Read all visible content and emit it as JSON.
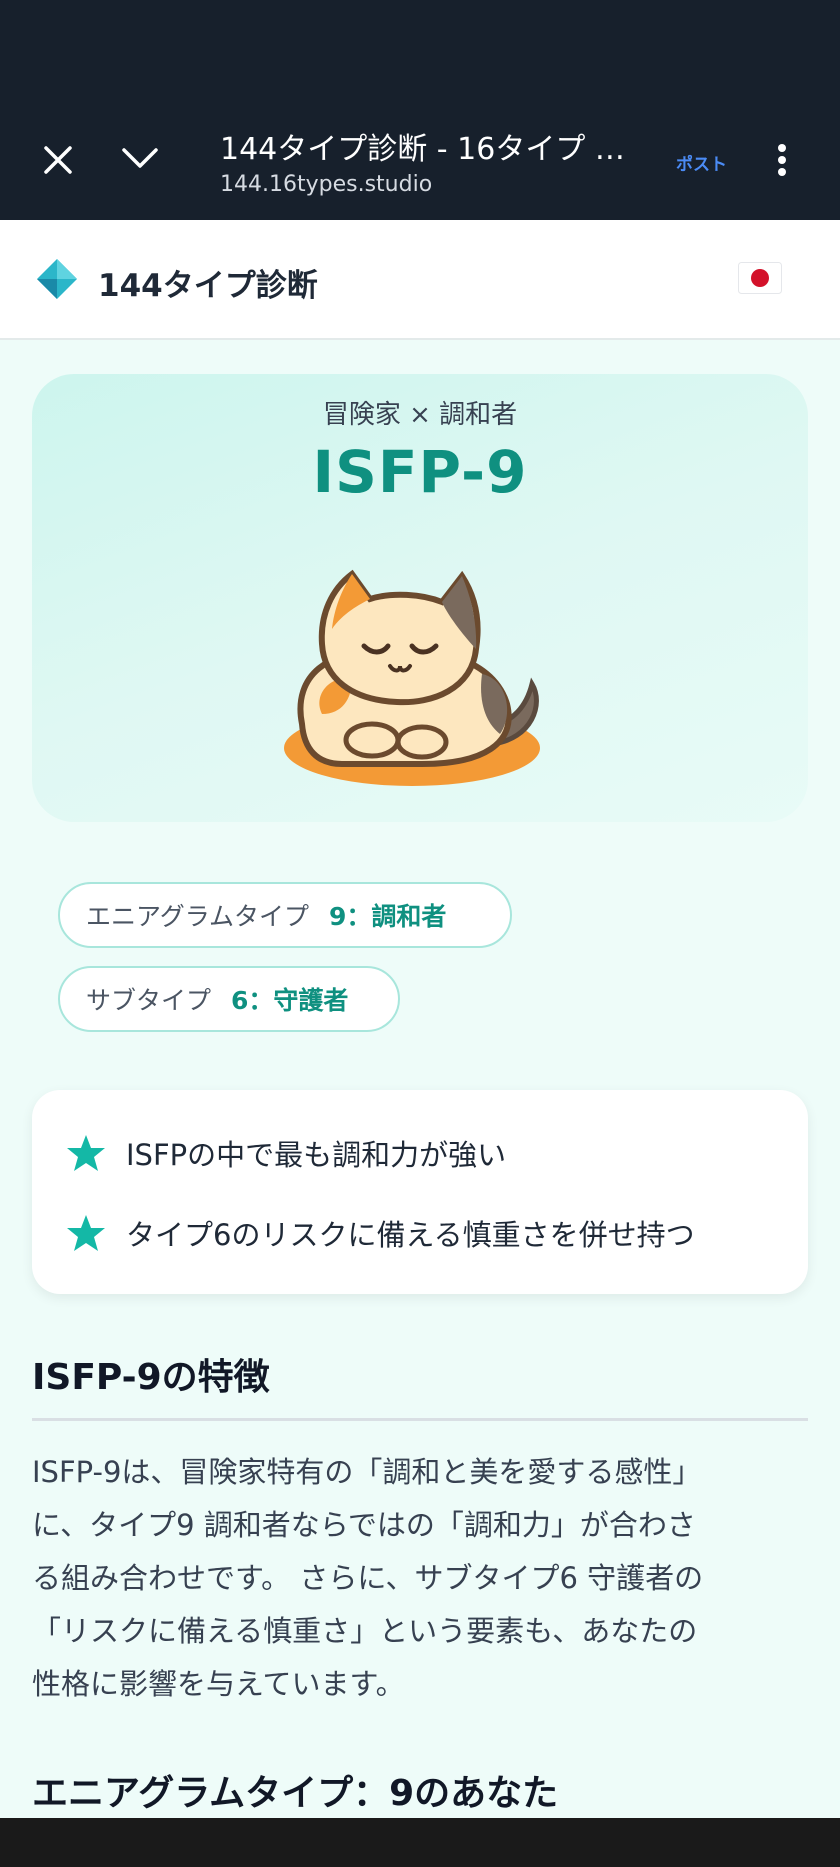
{
  "browser": {
    "tab_title": "144タイプ診断 - 16タイプ …",
    "url": "144.16types.studio",
    "post_label": "ポスト"
  },
  "header": {
    "site_title": "144タイプ診断",
    "flag_icon": "japan-flag-icon"
  },
  "hero": {
    "subtitle": "冒険家 × 調和者",
    "type_code": "ISFP-9",
    "illustration": "sleeping-cat-icon"
  },
  "badges": [
    {
      "label": "エニアグラムタイプ",
      "value": "9：調和者"
    },
    {
      "label": "サブタイプ",
      "value": "6：守護者"
    }
  ],
  "highlights": [
    "ISFPの中で最も調和力が強い",
    "タイプ6のリスクに備える慎重さを併せ持つ"
  ],
  "section": {
    "title": "ISFP-9の特徴",
    "body_lines": [
      "ISFP-9は、冒険家特有の「調和と美を愛する感性」",
      "に、タイプ9 調和者ならではの「調和力」が合わさ",
      "る組み合わせです。 さらに、サブタイプ6 守護者の",
      "「リスクに備える慎重さ」という要素も、あなたの",
      "性格に影響を与えています。"
    ]
  },
  "section2": {
    "title": "エニアグラムタイプ：9のあなた"
  },
  "colors": {
    "accent": "#0f9080",
    "star": "#14b8a6",
    "chrome_bg": "#17202c"
  }
}
